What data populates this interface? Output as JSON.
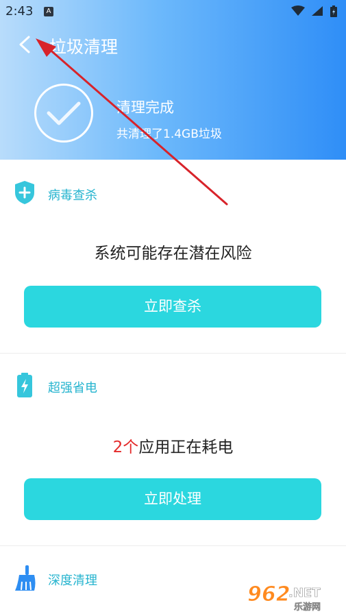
{
  "status_bar": {
    "time": "2:43",
    "a_icon": "A"
  },
  "header": {
    "title": "垃圾清理",
    "result_title": "清理完成",
    "result_detail": "共清理了1.4GB垃圾"
  },
  "virus": {
    "title": "病毒查杀",
    "message": "系统可能存在潜在风险",
    "button": "立即查杀"
  },
  "power": {
    "title": "超强省电",
    "count": "2个",
    "message_rest": "应用正在耗电",
    "button": "立即处理"
  },
  "deep": {
    "title": "深度清理"
  },
  "watermark": {
    "brand": "962",
    "suffix": ".NET",
    "site": "乐游网"
  },
  "colors": {
    "accent": "#2bd7df",
    "title_accent": "#26b4cf",
    "header_start": "#b8dcfb",
    "header_end": "#2f8ef7",
    "alert": "#e42a2a",
    "annotation_arrow": "#d8232a"
  }
}
